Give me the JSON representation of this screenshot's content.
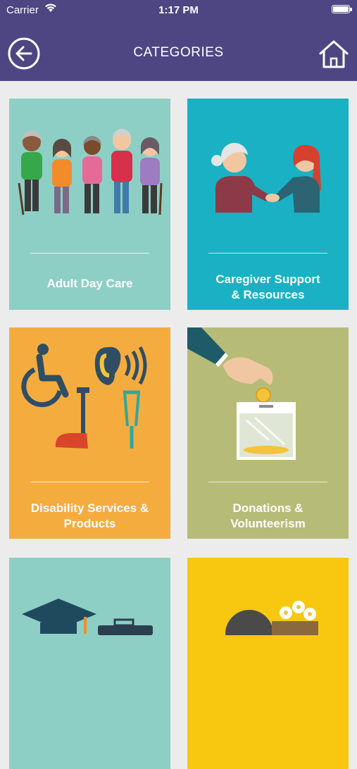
{
  "status_bar": {
    "carrier": "Carrier",
    "time": "1:17 PM"
  },
  "header": {
    "title": "CATEGORIES",
    "back_icon": "back-arrow-icon",
    "home_icon": "home-icon"
  },
  "colors": {
    "header_bg": "#4e4682",
    "adult_day_care": "#8ecfc5",
    "caregiver": "#19b1c3",
    "disability": "#f5ac3f",
    "donations": "#b6bc77",
    "education": "#8ecfc5",
    "yellow": "#f7c80f"
  },
  "categories": [
    {
      "label": "Adult Day Care",
      "illustration": "seniors-group-icon"
    },
    {
      "label": "Caregiver Support\n& Resources",
      "illustration": "handshake-icon"
    },
    {
      "label": "Disability Services &\nProducts",
      "illustration": "accessibility-icons"
    },
    {
      "label": "Donations &\nVolunteerism",
      "illustration": "donation-box-icon"
    },
    {
      "label": "",
      "illustration": "graduation-cap-icon"
    },
    {
      "label": "",
      "illustration": "planter-icon"
    }
  ]
}
